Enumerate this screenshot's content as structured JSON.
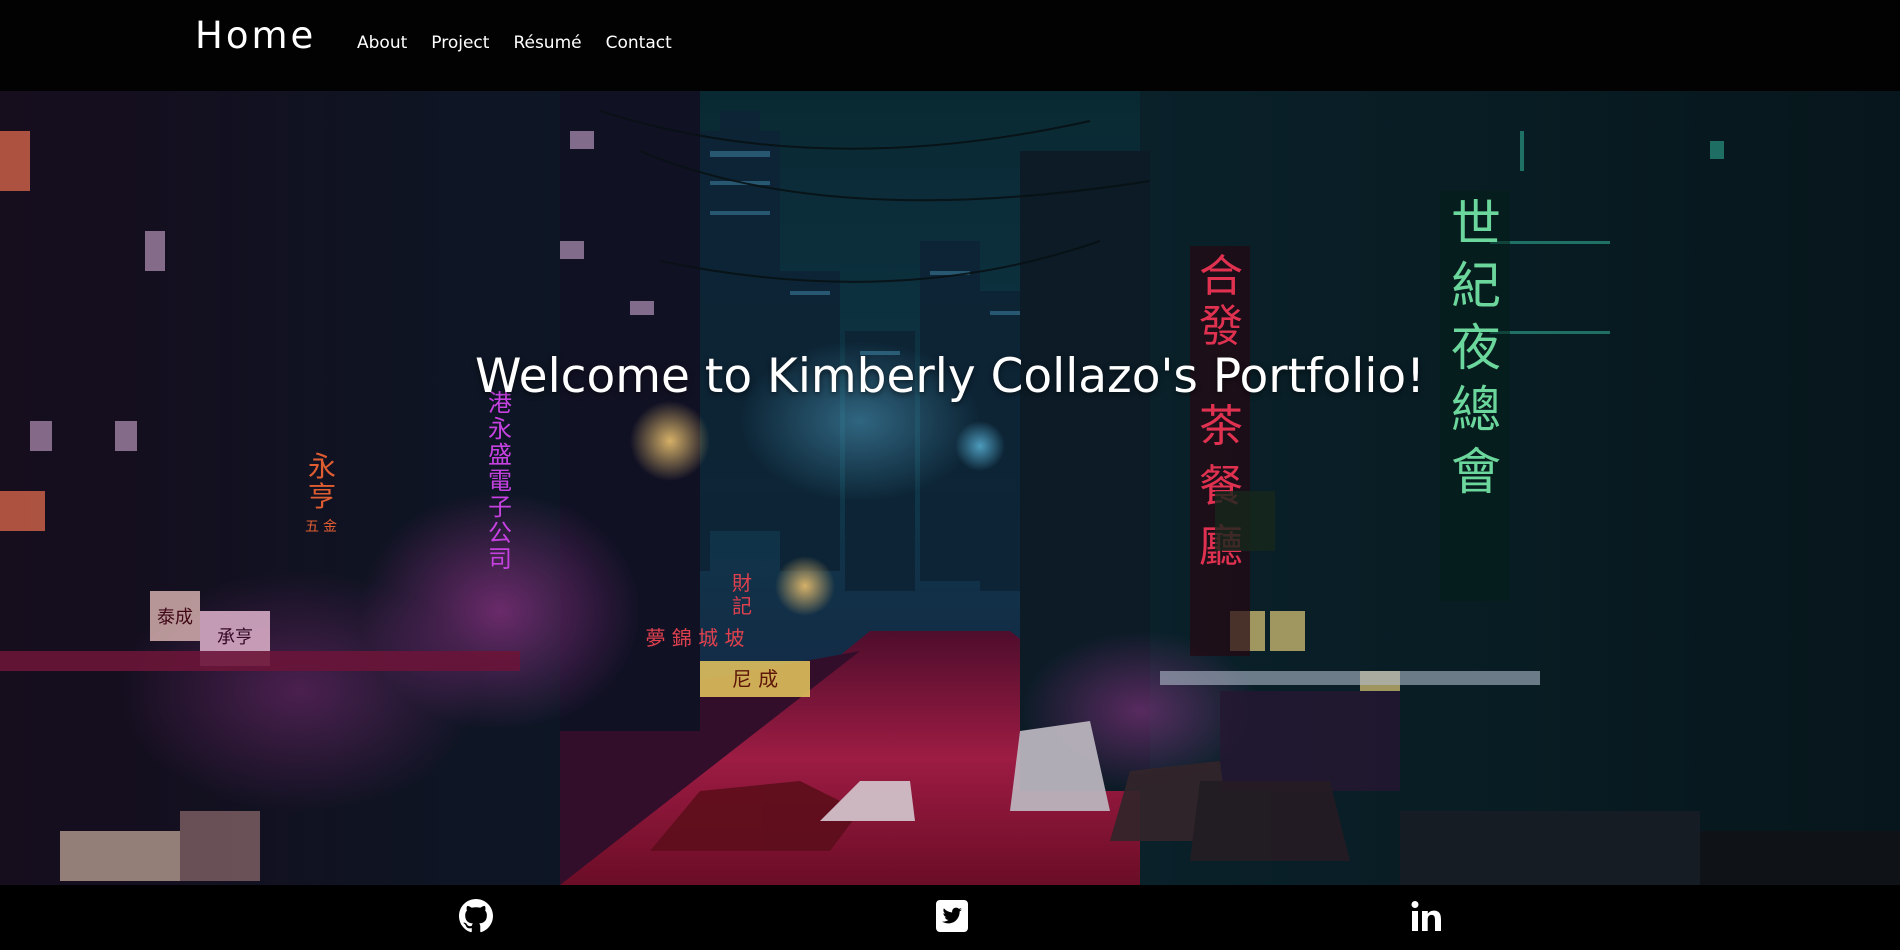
{
  "navbar": {
    "brand": "Home",
    "links": [
      {
        "label": "About"
      },
      {
        "label": "Project"
      },
      {
        "label": "Résumé"
      },
      {
        "label": "Contact"
      }
    ]
  },
  "hero": {
    "title": "Welcome to Kimberly Collazo's Portfolio!",
    "signs": {
      "green_vertical": [
        "世",
        "紀",
        "夜",
        "總",
        "會"
      ],
      "red_vertical": [
        "合",
        "發",
        "茶",
        "餐",
        "廳"
      ],
      "magenta_vertical": [
        "港",
        "永",
        "盛",
        "電",
        "子",
        "公",
        "司"
      ],
      "left_orange": [
        "永",
        "亨",
        "五",
        "金"
      ],
      "fortune": [
        "財",
        "記"
      ],
      "street_row": "夢 錦 城 坡",
      "shop_box": "泰成",
      "shop_box2": "承亨",
      "yellow_sign": "尼 成"
    },
    "colors": {
      "sky": "#0e3a46",
      "street": "#b3204d",
      "neon_green": "#7cf5b2",
      "neon_red": "#ff3a5c",
      "neon_magenta": "#e14bff"
    }
  },
  "footer": {
    "icons": [
      "github-icon",
      "twitter-icon",
      "linkedin-icon"
    ]
  }
}
